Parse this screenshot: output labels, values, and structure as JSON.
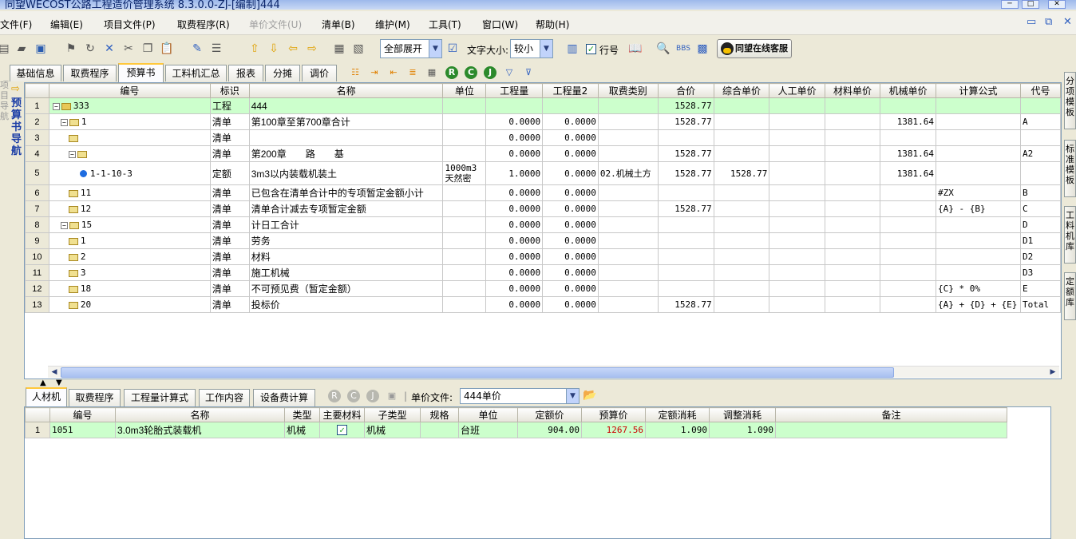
{
  "title": "同望WECOST公路工程造价管理系统 8.3.0.0-ZJ-[编制]444",
  "menu": [
    "文件(F)",
    "编辑(E)",
    "项目文件(P)",
    "取费程序(R)",
    "单价文件(U)",
    "清单(B)",
    "维护(M)",
    "工具(T)",
    "窗口(W)",
    "帮助(H)"
  ],
  "toolbar": {
    "expand_select": "全部展开",
    "font_size_label": "文字大小:",
    "font_size_value": "较小",
    "row_number_label": "行号",
    "online_service": "同望在线客服"
  },
  "left_nav": {
    "label": "预算书导航",
    "faded": "项目导航"
  },
  "tabs": [
    "基础信息",
    "取费程序",
    "预算书",
    "工料机汇总",
    "报表",
    "分摊",
    "调价"
  ],
  "active_tab": "预算书",
  "columns": [
    "编号",
    "标识",
    "名称",
    "单位",
    "工程量",
    "工程量2",
    "取费类别",
    "合价",
    "综合单价",
    "人工单价",
    "材料单价",
    "机械单价",
    "计算公式",
    "代号"
  ],
  "rows": [
    {
      "n": "1",
      "code": "333",
      "tag": "工程",
      "name": "444",
      "unit": "",
      "qty": "",
      "qty2": "",
      "fee": "",
      "total": "1528.77",
      "uprice": "",
      "labor": "",
      "material": "",
      "machine": "",
      "formula": "",
      "cd": ""
    },
    {
      "n": "2",
      "code": "1",
      "tag": "清单",
      "name": "第100章至第700章合计",
      "unit": "",
      "qty": "0.0000",
      "qty2": "0.0000",
      "fee": "",
      "total": "1528.77",
      "uprice": "",
      "labor": "",
      "material": "",
      "machine": "1381.64",
      "formula": "",
      "cd": "A"
    },
    {
      "n": "3",
      "code": "",
      "tag": "清单",
      "name": "",
      "unit": "",
      "qty": "0.0000",
      "qty2": "0.0000",
      "fee": "",
      "total": "",
      "uprice": "",
      "labor": "",
      "material": "",
      "machine": "",
      "formula": "",
      "cd": ""
    },
    {
      "n": "4",
      "code": "",
      "tag": "清单",
      "name": "第200章　　路　　基",
      "unit": "",
      "qty": "0.0000",
      "qty2": "0.0000",
      "fee": "",
      "total": "1528.77",
      "uprice": "",
      "labor": "",
      "material": "",
      "machine": "1381.64",
      "formula": "",
      "cd": "A2"
    },
    {
      "n": "5",
      "code": "1-1-10-3",
      "tag": "定额",
      "name": "3m3以内装载机装土",
      "unit": "1000m3天然密",
      "qty": "1.0000",
      "qty2": "0.0000",
      "fee": "02.机械土方",
      "total": "1528.77",
      "uprice": "1528.77",
      "labor": "",
      "material": "",
      "machine": "1381.64",
      "formula": "",
      "cd": ""
    },
    {
      "n": "6",
      "code": "11",
      "tag": "清单",
      "name": "已包含在清单合计中的专项暂定金额小计",
      "unit": "",
      "qty": "0.0000",
      "qty2": "0.0000",
      "fee": "",
      "total": "",
      "uprice": "",
      "labor": "",
      "material": "",
      "machine": "",
      "formula": "#ZX",
      "cd": "B"
    },
    {
      "n": "7",
      "code": "12",
      "tag": "清单",
      "name": "清单合计减去专项暂定金额",
      "unit": "",
      "qty": "0.0000",
      "qty2": "0.0000",
      "fee": "",
      "total": "1528.77",
      "uprice": "",
      "labor": "",
      "material": "",
      "machine": "",
      "formula": "{A} - {B}",
      "cd": "C"
    },
    {
      "n": "8",
      "code": "15",
      "tag": "清单",
      "name": "计日工合计",
      "unit": "",
      "qty": "0.0000",
      "qty2": "0.0000",
      "fee": "",
      "total": "",
      "uprice": "",
      "labor": "",
      "material": "",
      "machine": "",
      "formula": "",
      "cd": "D"
    },
    {
      "n": "9",
      "code": "1",
      "tag": "清单",
      "name": "劳务",
      "unit": "",
      "qty": "0.0000",
      "qty2": "0.0000",
      "fee": "",
      "total": "",
      "uprice": "",
      "labor": "",
      "material": "",
      "machine": "",
      "formula": "",
      "cd": "D1"
    },
    {
      "n": "10",
      "code": "2",
      "tag": "清单",
      "name": "材料",
      "unit": "",
      "qty": "0.0000",
      "qty2": "0.0000",
      "fee": "",
      "total": "",
      "uprice": "",
      "labor": "",
      "material": "",
      "machine": "",
      "formula": "",
      "cd": "D2"
    },
    {
      "n": "11",
      "code": "3",
      "tag": "清单",
      "name": "施工机械",
      "unit": "",
      "qty": "0.0000",
      "qty2": "0.0000",
      "fee": "",
      "total": "",
      "uprice": "",
      "labor": "",
      "material": "",
      "machine": "",
      "formula": "",
      "cd": "D3"
    },
    {
      "n": "12",
      "code": "18",
      "tag": "清单",
      "name": "不可预见费（暂定金额）",
      "unit": "",
      "qty": "0.0000",
      "qty2": "0.0000",
      "fee": "",
      "total": "",
      "uprice": "",
      "labor": "",
      "material": "",
      "machine": "",
      "formula": "{C} *  0%",
      "cd": "E"
    },
    {
      "n": "13",
      "code": "20",
      "tag": "清单",
      "name": "投标价",
      "unit": "",
      "qty": "0.0000",
      "qty2": "0.0000",
      "fee": "",
      "total": "1528.77",
      "uprice": "",
      "labor": "",
      "material": "",
      "machine": "",
      "formula": "{A} + {D} + {E}",
      "cd": "Total"
    }
  ],
  "bottom_tabs": [
    "人材机",
    "取费程序",
    "工程量计算式",
    "工作内容",
    "设备费计算"
  ],
  "unit_file_label": "单价文件:",
  "unit_file_value": "444单价",
  "bottom_columns": [
    "编号",
    "名称",
    "类型",
    "主要材料",
    "子类型",
    "规格",
    "单位",
    "定额价",
    "预算价",
    "定额消耗",
    "调整消耗",
    "备注"
  ],
  "bottom_rows": [
    {
      "n": "1",
      "code": "1051",
      "name": "3.0m3轮胎式装载机",
      "type": "机械",
      "main": true,
      "subtype": "机械",
      "spec": "",
      "unit": "台班",
      "quota_price": "904.00",
      "budget_price": "1267.56",
      "quota_use": "1.090",
      "adj_use": "1.090",
      "remark": ""
    }
  ],
  "right_tabs": [
    "分项模板",
    "标准模板",
    "工料机库",
    "定额库"
  ],
  "colors": {
    "row_highlight": "#CCFFCC",
    "accent": "#1A3DA6",
    "budget_price": "#CC0000"
  }
}
